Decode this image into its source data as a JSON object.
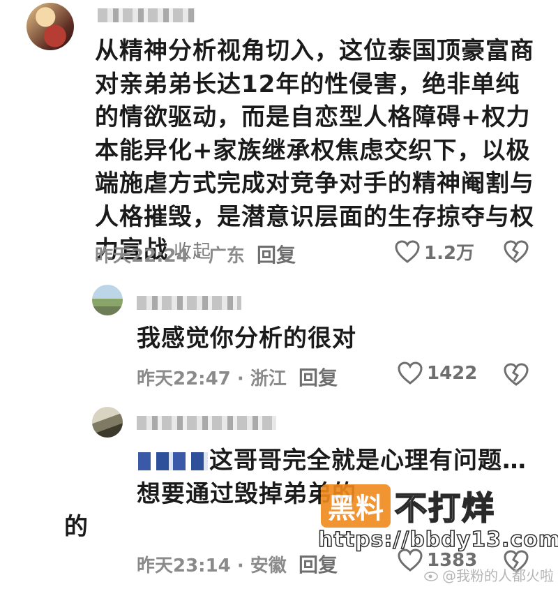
{
  "comments": [
    {
      "text": "从精神分析视角切入，这位泰国顶豪富商对亲弟弟长达12年的性侵害，绝非单纯的情欲驱动，而是自恋型人格障碍+权力本能异化+家族继承权焦虑交织下，以极端施虐方式完成对竞争对手的精神阉割与人格摧毁，是潜意识层面的生存掠夺与权力宣战",
      "collapse_label": "收起",
      "time_location": "昨天22:24 · 广东",
      "reply_label": "回复",
      "likes": "1.2万"
    },
    {
      "text": "我感觉你分析的很对",
      "time_location": "昨天22:47 · 浙江",
      "reply_label": "回复",
      "likes": "1422"
    },
    {
      "text_visible": "这哥哥完全就是心理有问题…想要通过毁掉弟弟的",
      "text_tail": "的",
      "time_location": "昨天23:14 · 安徽",
      "reply_label": "回复",
      "likes": "1383"
    }
  ],
  "watermark": {
    "badge": "黑料",
    "text": "不打烊",
    "url": "https://bbdy13.com",
    "weibo": "@我粉的人都火啦"
  },
  "colors": {
    "text": "#1a1a1a",
    "meta": "#8a8a8a",
    "watermark_badge": "#f08a1e"
  }
}
